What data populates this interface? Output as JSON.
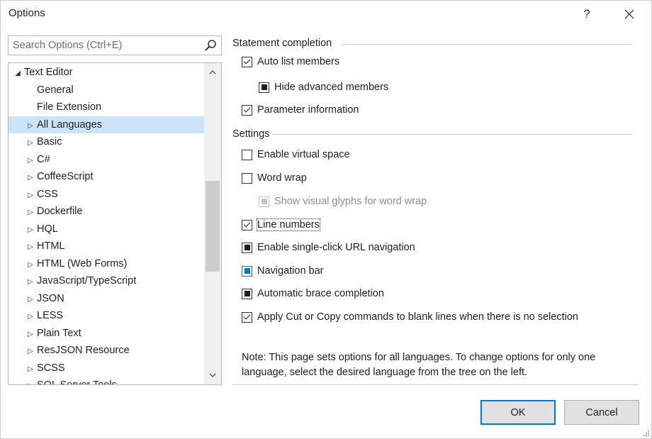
{
  "window": {
    "title": "Options",
    "help_label": "?",
    "close_label": "✕"
  },
  "search": {
    "placeholder": "Search Options (Ctrl+E)"
  },
  "tree": {
    "items": [
      {
        "label": "Text Editor",
        "arrow": "◢",
        "level": 0,
        "selected": false
      },
      {
        "label": "General",
        "arrow": "",
        "level": 1,
        "selected": false
      },
      {
        "label": "File Extension",
        "arrow": "",
        "level": 1,
        "selected": false
      },
      {
        "label": "All Languages",
        "arrow": "▷",
        "level": 1,
        "selected": true
      },
      {
        "label": "Basic",
        "arrow": "▷",
        "level": 1,
        "selected": false
      },
      {
        "label": "C#",
        "arrow": "▷",
        "level": 1,
        "selected": false
      },
      {
        "label": "CoffeeScript",
        "arrow": "▷",
        "level": 1,
        "selected": false
      },
      {
        "label": "CSS",
        "arrow": "▷",
        "level": 1,
        "selected": false
      },
      {
        "label": "Dockerfile",
        "arrow": "▷",
        "level": 1,
        "selected": false
      },
      {
        "label": "HQL",
        "arrow": "▷",
        "level": 1,
        "selected": false
      },
      {
        "label": "HTML",
        "arrow": "▷",
        "level": 1,
        "selected": false
      },
      {
        "label": "HTML (Web Forms)",
        "arrow": "▷",
        "level": 1,
        "selected": false
      },
      {
        "label": "JavaScript/TypeScript",
        "arrow": "▷",
        "level": 1,
        "selected": false
      },
      {
        "label": "JSON",
        "arrow": "▷",
        "level": 1,
        "selected": false
      },
      {
        "label": "LESS",
        "arrow": "▷",
        "level": 1,
        "selected": false
      },
      {
        "label": "Plain Text",
        "arrow": "▷",
        "level": 1,
        "selected": false
      },
      {
        "label": "ResJSON Resource",
        "arrow": "▷",
        "level": 1,
        "selected": false
      },
      {
        "label": "SCSS",
        "arrow": "▷",
        "level": 1,
        "selected": false
      },
      {
        "label": "SQL Server Tools",
        "arrow": "▷",
        "level": 1,
        "selected": false
      }
    ]
  },
  "statement_completion": {
    "title": "Statement completion",
    "options": [
      {
        "name": "auto-list-members",
        "label": "Auto list members",
        "state": "checked",
        "indent": 0
      },
      {
        "name": "hide-advanced-members",
        "label": "Hide advanced members",
        "state": "indeterminate",
        "indent": 1
      },
      {
        "name": "parameter-information",
        "label": "Parameter information",
        "state": "checked",
        "indent": 0
      }
    ]
  },
  "settings": {
    "title": "Settings",
    "options": [
      {
        "name": "enable-virtual-space",
        "label": "Enable virtual space",
        "state": "unchecked",
        "indent": 0
      },
      {
        "name": "word-wrap",
        "label": "Word wrap",
        "state": "unchecked",
        "indent": 0
      },
      {
        "name": "show-visual-glyphs",
        "label": "Show visual glyphs for word wrap",
        "state": "disabled",
        "indent": 1
      },
      {
        "name": "line-numbers",
        "label": "Line numbers",
        "state": "checked",
        "indent": 0
      },
      {
        "name": "single-click-url-navigation",
        "label": "Enable single-click URL navigation",
        "state": "indeterminate",
        "indent": 0
      },
      {
        "name": "navigation-bar",
        "label": "Navigation bar",
        "state": "indeterminate-blue",
        "indent": 0
      },
      {
        "name": "automatic-brace-completion",
        "label": "Automatic brace completion",
        "state": "indeterminate",
        "indent": 0
      },
      {
        "name": "apply-cut-copy-blank-lines",
        "label": "Apply Cut or Copy commands to blank lines when there is no selection",
        "state": "checked",
        "indent": 0
      }
    ]
  },
  "note": "Note: This page sets options for all languages. To change options for only one language, select the desired language from the tree on the left.",
  "buttons": {
    "ok": "OK",
    "cancel": "Cancel"
  },
  "colors": {
    "accent": "#0078d7",
    "selection": "#cce4f7"
  }
}
